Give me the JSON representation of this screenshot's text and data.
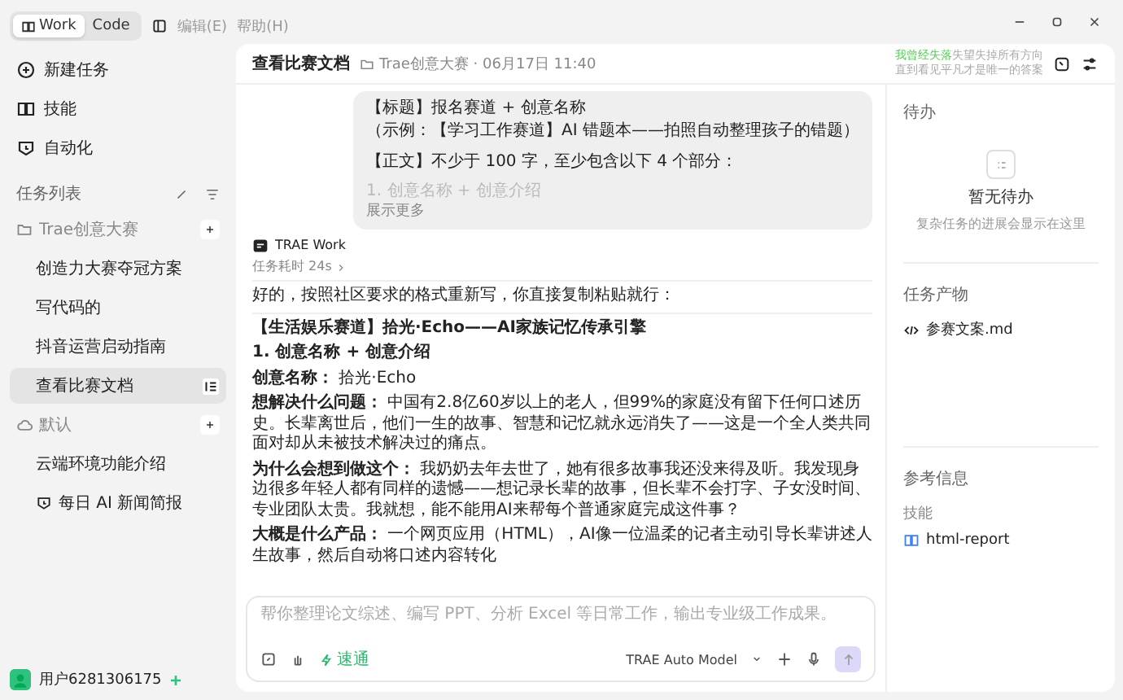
{
  "toolbar": {
    "modes": [
      {
        "label": "Work",
        "selected": true
      },
      {
        "label": "Code",
        "selected": false
      }
    ],
    "menus": [
      "编辑(E)",
      "帮助(H)"
    ]
  },
  "nav": [
    {
      "label": "新建任务",
      "kind": "new"
    },
    {
      "label": "技能",
      "kind": "skills"
    },
    {
      "label": "自动化",
      "kind": "automation"
    }
  ],
  "task_list": {
    "title": "任务列表",
    "groups": [
      {
        "name": "Trae创意大赛",
        "kind": "folder",
        "children": [
          {
            "label": "创造力大赛夺冠方案",
            "selected": false,
            "kind": "plain"
          },
          {
            "label": "写代码的",
            "selected": false,
            "kind": "plain"
          },
          {
            "label": "抖音运营启动指南",
            "selected": false,
            "kind": "plain"
          },
          {
            "label": "查看比赛文档",
            "selected": true,
            "kind": "plain"
          }
        ]
      },
      {
        "name": "默认",
        "kind": "cloud",
        "children": [
          {
            "label": "云端环境功能介绍",
            "selected": false,
            "kind": "plain"
          },
          {
            "label": "每日 AI 新闻简报",
            "selected": false,
            "kind": "scheduled"
          }
        ]
      }
    ]
  },
  "user": {
    "name": "用户6281306175"
  },
  "header": {
    "title": "查看比赛文档",
    "project": "Trae创意大赛 · 06月17日 11:40",
    "lyrics": {
      "sung": "我曾经失落",
      "rest": "失望失掉所有方向",
      "line2": "直到看见平凡才是唯一的答案"
    }
  },
  "chat": {
    "user_message": {
      "paragraphs": [
        "【标题】报名赛道 + 创意名称",
        "（示例：【学习工作赛道】AI 错题本——拍照自动整理孩子的错题）",
        "【正文】不少于 100 字，至少包含以下 4 个部分："
      ],
      "faded": "1. 创意名称 + 创意介绍",
      "show_more": "展示更多"
    },
    "agent": {
      "name": "TRAE Work",
      "duration": "任务耗时 24s",
      "intro": "好的，按照社区要求的格式重新写，你直接复制粘贴就行：",
      "blocks": [
        {
          "kind": "heading",
          "text": "【生活娱乐赛道】拾光·Echo——AI家族记忆传承引擎"
        },
        {
          "kind": "heading",
          "text": "1. 创意名称 + 创意介绍"
        },
        {
          "kind": "paragraph",
          "text": "**创意名称：** 拾光·Echo"
        },
        {
          "kind": "paragraph",
          "text": "**想解决什么问题：** 中国有2.8亿60岁以上的老人，但99%的家庭没有留下任何口述历史。长辈离世后，他们一生的故事、智慧和记忆就永远消失了——这是一个全人类共同面对却从未被技术解决过的痛点。"
        },
        {
          "kind": "paragraph",
          "text": "**为什么会想到做这个：** 我奶奶去年去世了，她有很多故事我还没来得及听。我发现身边很多年轻人都有同样的遗憾——想记录长辈的故事，但长辈不会打字、子女没时间、专业团队太贵。我就想，能不能用AI来帮每个普通家庭完成这件事？"
        },
        {
          "kind": "paragraph",
          "text": "**大概是什么产品：** 一个网页应用（HTML），AI像一位温柔的记者主动引导长辈讲述人生故事，然后自动将口述内容转化"
        }
      ]
    }
  },
  "composer": {
    "placeholder": "帮你整理论文综述、编写 PPT、分析 Excel 等日常工作，输出专业级工作成果。",
    "mode": "速通",
    "model": "TRAE Auto Model"
  },
  "panel": {
    "todo": {
      "title": "待办",
      "empty_title": "暂无待办",
      "empty_hint": "复杂任务的进展会显示在这里"
    },
    "outputs": {
      "title": "任务产物",
      "files": [
        "参赛文案.md"
      ]
    },
    "reference": {
      "title": "参考信息",
      "skills_label": "技能",
      "skills": [
        "html-report"
      ]
    }
  }
}
